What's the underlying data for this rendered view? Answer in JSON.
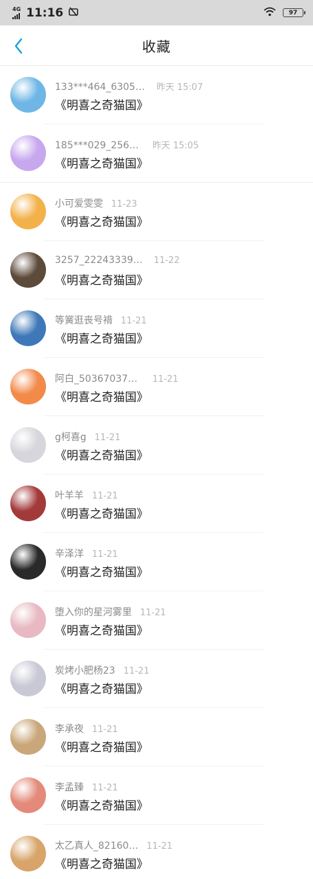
{
  "status_bar": {
    "network": "4G",
    "time": "11:16",
    "silent_icon": "silent-mode-icon",
    "wifi_icon": "wifi-icon",
    "battery": "97"
  },
  "header": {
    "back_icon": "chevron-left-icon",
    "title": "收藏"
  },
  "colors": {
    "accent": "#1e9fd6",
    "divider": "#eeeeee",
    "name_text": "#8a8a8a",
    "time_text": "#b7b7b7"
  },
  "favorites": [
    {
      "name": "133***464_6305…",
      "time": "昨天 15:07",
      "work": "《明喜之奇猫国》",
      "avatar_color": "#6fb6e6",
      "avatar_icon": "sheep-avatar"
    },
    {
      "name": "185***029_256…",
      "time": "昨天 15:05",
      "work": "《明喜之奇猫国》",
      "avatar_color": "#c7a7ee",
      "avatar_icon": "chat-bubble-avatar"
    },
    {
      "name": "小可爱雯雯",
      "time": "11-23",
      "work": "《明喜之奇猫国》",
      "avatar_color": "#f3b14a",
      "avatar_icon": "cartoon-dog-avatar"
    },
    {
      "name": "3257_22243339…",
      "time": "11-22",
      "work": "《明喜之奇猫国》",
      "avatar_color": "#5c4a3a",
      "avatar_icon": "landscape-avatar"
    },
    {
      "name": "等黉逛丧号褙",
      "time": "11-21",
      "work": "《明喜之奇猫国》",
      "avatar_color": "#3f78b8",
      "avatar_icon": "sky-avatar"
    },
    {
      "name": "阿白_50367037…",
      "time": "11-21",
      "work": "《明喜之奇猫国》",
      "avatar_color": "#f28a4a",
      "avatar_icon": "cartoon-animal-avatar"
    },
    {
      "name": "g柯喜g",
      "time": "11-21",
      "work": "《明喜之奇猫国》",
      "avatar_color": "#d6d6dc",
      "avatar_icon": "sheep-avatar"
    },
    {
      "name": "叶羊羊",
      "time": "11-21",
      "work": "《明喜之奇猫国》",
      "avatar_color": "#a33a3a",
      "avatar_icon": "portrait-avatar"
    },
    {
      "name": "辛泽洋",
      "time": "11-21",
      "work": "《明喜之奇猫国》",
      "avatar_color": "#2a2a2a",
      "avatar_icon": "portrait-avatar"
    },
    {
      "name": "堕入你的星河雾里",
      "time": "11-21",
      "work": "《明喜之奇猫国》",
      "avatar_color": "#e8b9c2",
      "avatar_icon": "anime-girl-avatar"
    },
    {
      "name": "炭烤小肥杨23",
      "time": "11-21",
      "work": "《明喜之奇猫国》",
      "avatar_color": "#c9c9d6",
      "avatar_icon": "anime-avatar"
    },
    {
      "name": "李承夜",
      "time": "11-21",
      "work": "《明喜之奇猫国》",
      "avatar_color": "#c9a77a",
      "avatar_icon": "portrait-avatar"
    },
    {
      "name": "李孟臻",
      "time": "11-21",
      "work": "《明喜之奇猫国》",
      "avatar_color": "#e48a7a",
      "avatar_icon": "baby-avatar"
    },
    {
      "name": "太乙真人_82160…",
      "time": "11-21",
      "work": "《明喜之奇猫国》",
      "avatar_color": "#d8a46a",
      "avatar_icon": "hand-avatar"
    }
  ]
}
